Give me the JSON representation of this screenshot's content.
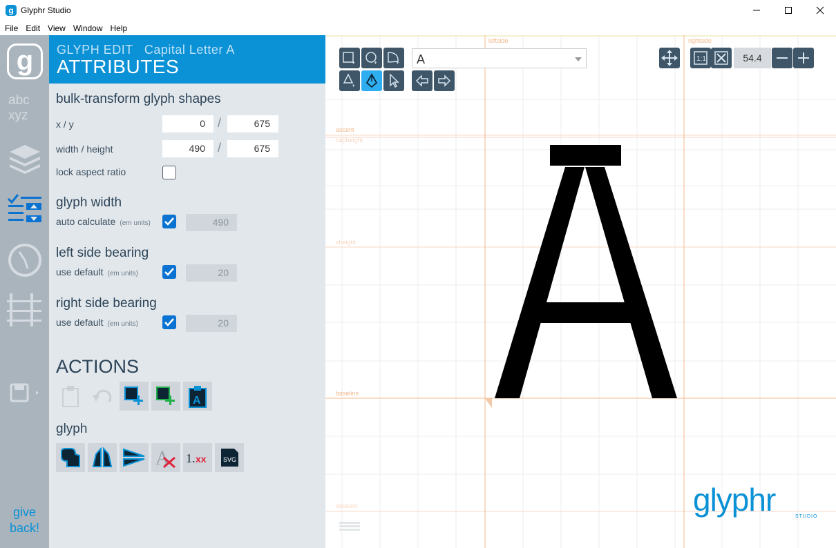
{
  "window": {
    "title": "Glyphr Studio",
    "app_icon": "glyphr-g-icon"
  },
  "menu": [
    "File",
    "Edit",
    "View",
    "Window",
    "Help"
  ],
  "nav": {
    "logo_glyph": "g",
    "items": [
      "characters-icon",
      "layers-icon",
      "attributes-icon",
      "metrics-icon",
      "guides-icon",
      "save-icon"
    ],
    "give_back": [
      "give",
      "back!"
    ]
  },
  "panel": {
    "breadcrumb": "GLYPH EDIT   Capital Letter A",
    "title": "ATTRIBUTES",
    "bulk_transform": {
      "title": "bulk-transform glyph shapes",
      "xy_label": "x / y",
      "x": "0",
      "y": "675",
      "wh_label": "width / height",
      "width": "490",
      "height": "675",
      "lock_label": "lock aspect ratio",
      "lock_checked": false
    },
    "glyph_width": {
      "title": "glyph width",
      "label": "auto calculate",
      "units": "(em units)",
      "checked": true,
      "value": "490"
    },
    "left_side_bearing": {
      "title": "left side bearing",
      "label": "use default",
      "units": "(em units)",
      "checked": true,
      "value": "20"
    },
    "right_side_bearing": {
      "title": "right side bearing",
      "label": "use default",
      "units": "(em units)",
      "checked": true,
      "value": "20"
    },
    "actions_title": "ACTIONS",
    "glyph_section": "glyph"
  },
  "canvas": {
    "glyph_select_value": "A",
    "zoom_value": "54.4",
    "guides": {
      "leftside": "leftside",
      "rightside": "rightside",
      "ascent": "ascent",
      "capheight": "capheight",
      "xheight": "xheight",
      "baseline": "baseline",
      "descent": "descent"
    },
    "brand": "glyphr",
    "brand_sub": "STUDIO",
    "colors": {
      "accent": "#0a91d6",
      "guide": "#f3b98d",
      "grid": "#e8e8e8"
    }
  }
}
